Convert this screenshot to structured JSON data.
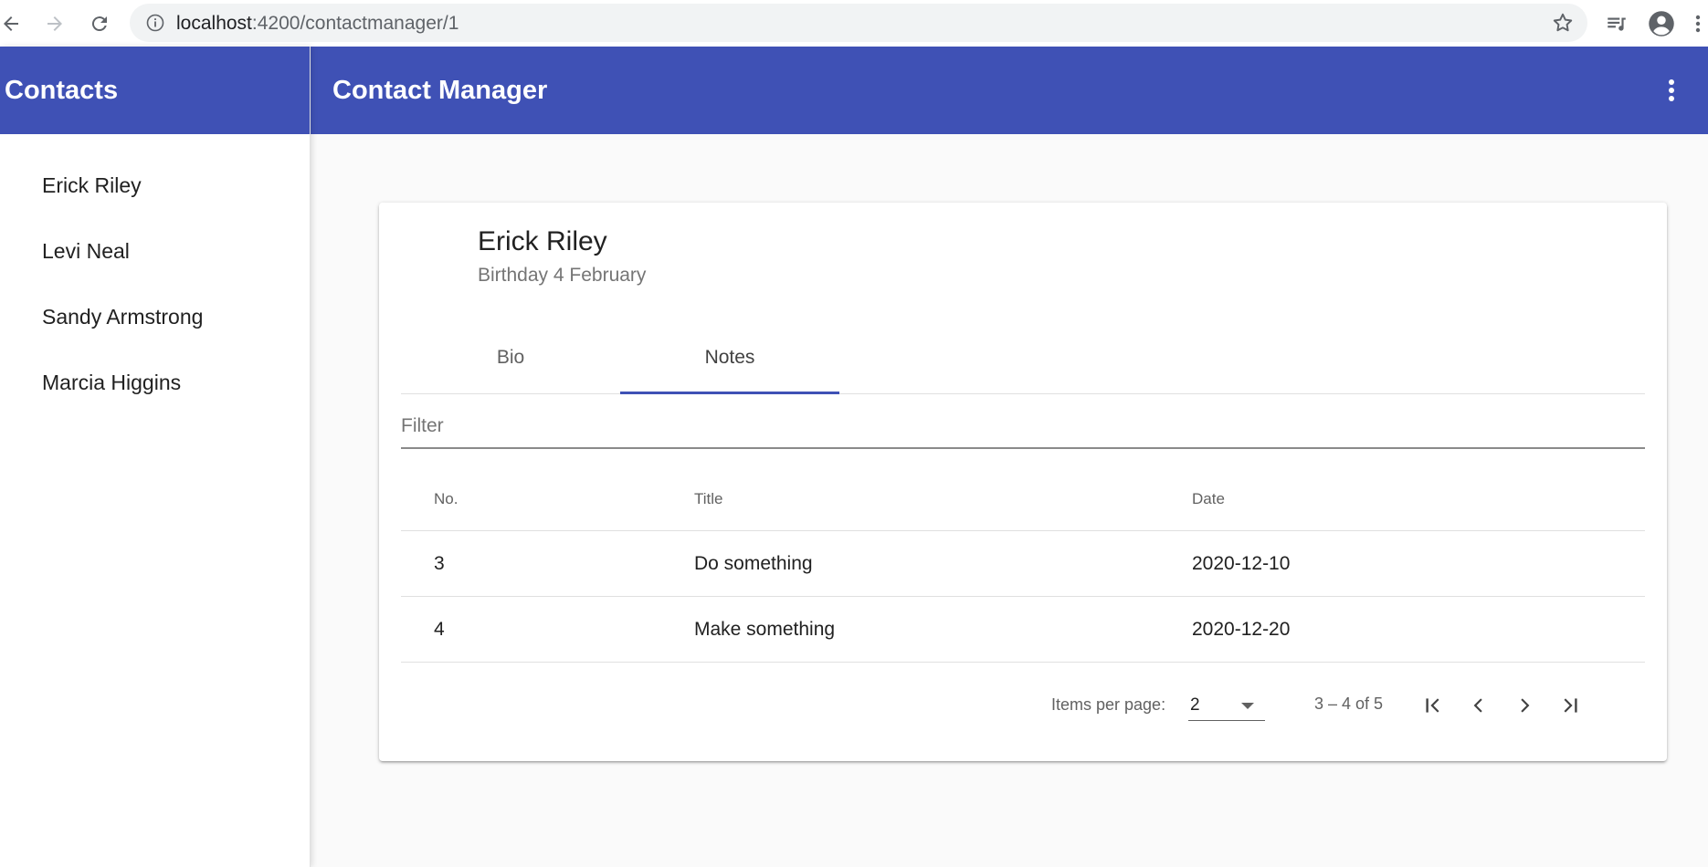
{
  "browser": {
    "url_host": "localhost",
    "url_path": ":4200/contactmanager/1"
  },
  "sidenav": {
    "title": "Contacts",
    "contacts": [
      "Erick Riley",
      "Levi Neal",
      "Sandy Armstrong",
      "Marcia Higgins"
    ]
  },
  "toolbar": {
    "title": "Contact Manager"
  },
  "card": {
    "name": "Erick Riley",
    "subtitle": "Birthday 4 February",
    "tabs": [
      {
        "label": "Bio",
        "active": false
      },
      {
        "label": "Notes",
        "active": true
      }
    ],
    "filter_placeholder": "Filter",
    "table": {
      "headers": {
        "no": "No.",
        "title": "Title",
        "date": "Date"
      },
      "rows": [
        {
          "no": "3",
          "title": "Do something",
          "date": "2020-12-10"
        },
        {
          "no": "4",
          "title": "Make something",
          "date": "2020-12-20"
        }
      ]
    },
    "paginator": {
      "items_per_page_label": "Items per page:",
      "page_size": "2",
      "range_label": "3 – 4 of 5"
    }
  },
  "colors": {
    "primary": "#3f51b5",
    "background": "#fafafa"
  }
}
